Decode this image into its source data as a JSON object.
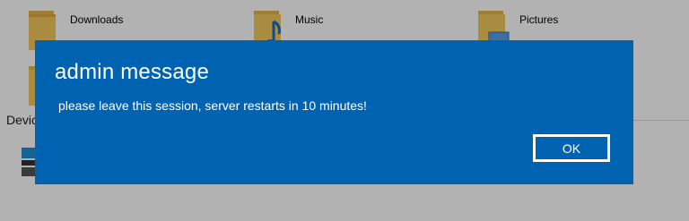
{
  "explorer": {
    "folders": [
      {
        "label": "Downloads",
        "icon": "downloads-folder-icon"
      },
      {
        "label": "Music",
        "icon": "music-folder-icon"
      },
      {
        "label": "Pictures",
        "icon": "pictures-folder-icon"
      }
    ],
    "section_label": "Devic"
  },
  "dialog": {
    "title": "admin message",
    "message": "please leave this session, server restarts in 10 minutes!",
    "ok_label": "OK",
    "accent_color": "#0063b1"
  }
}
